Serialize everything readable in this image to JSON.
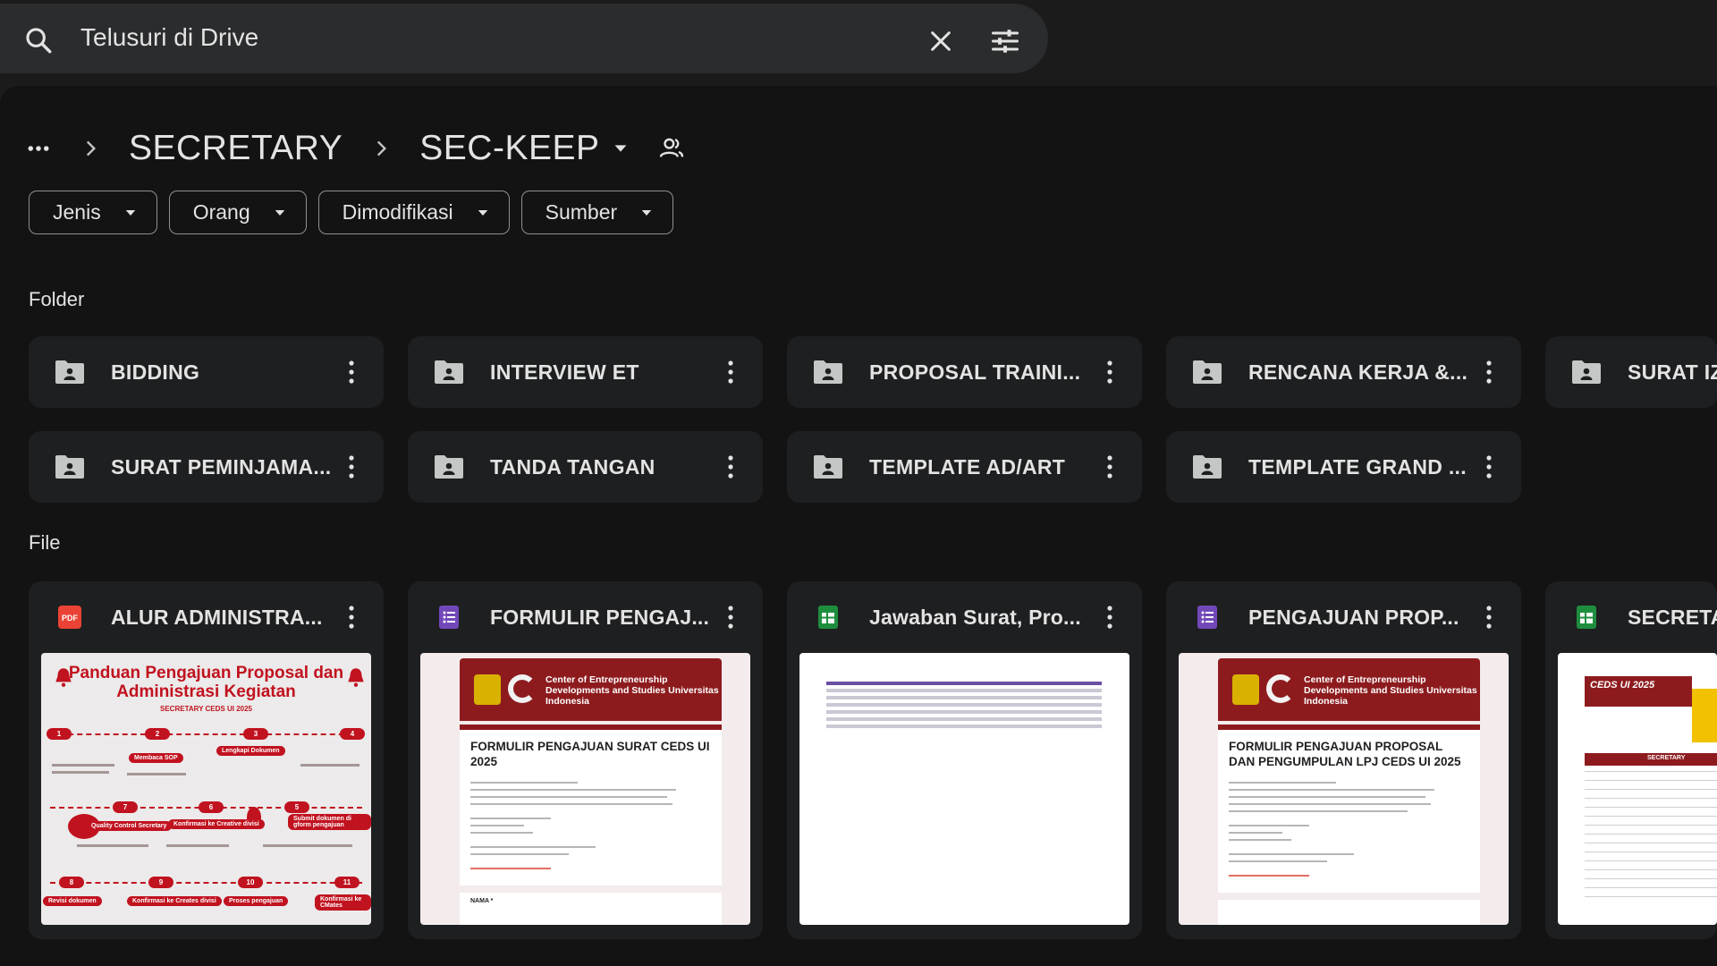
{
  "search": {
    "placeholder": "Telusuri di Drive"
  },
  "breadcrumb": {
    "parent": "SECRETARY",
    "current": "SEC-KEEP"
  },
  "filters": [
    "Jenis",
    "Orang",
    "Dimodifikasi",
    "Sumber"
  ],
  "sections": {
    "folders": "Folder",
    "files": "File"
  },
  "folders": [
    "BIDDING",
    "INTERVIEW ET",
    "PROPOSAL TRAINI...",
    "RENCANA KERJA &...",
    "SURAT IZI",
    "SURAT PEMINJAMA...",
    "TANDA TANGAN",
    "TEMPLATE AD/ART",
    "TEMPLATE GRAND ..."
  ],
  "files": [
    {
      "name": "ALUR ADMINISTRA...",
      "type": "pdf",
      "icon": "pdf-icon"
    },
    {
      "name": "FORMULIR PENGAJ...",
      "type": "form",
      "icon": "forms-icon"
    },
    {
      "name": "Jawaban Surat, Pro...",
      "type": "sheet",
      "icon": "sheets-icon"
    },
    {
      "name": "PENGAJUAN PROP...",
      "type": "form",
      "icon": "forms-icon"
    },
    {
      "name": "SECRETA",
      "type": "sheet",
      "icon": "sheets-icon"
    }
  ],
  "thumbs": {
    "info_title": "Panduan Pengajuan Proposal dan Administrasi Kegiatan",
    "info_sub": "SECRETARY CEDS UI 2025",
    "info_steps": [
      "1",
      "2",
      "3",
      "4",
      "7",
      "6",
      "5",
      "8",
      "9",
      "10",
      "11"
    ],
    "info_labels": [
      "Membaca SOP",
      "Lengkapi Dokumen",
      "Quality Control Secretary",
      "Konfirmasi ke Creative divisi",
      "Submit dokumen di gform pengajuan",
      "Revisi dokumen",
      "Konfirmasi ke Creates divisi",
      "Proses pengajuan",
      "Konfirmasi ke CMates"
    ],
    "org_name": "Center of Entrepreneurship Developments and Studies Universitas Indonesia",
    "form1_heading": "FORMULIR PENGAJUAN SURAT CEDS UI 2025",
    "form2_heading": "FORMULIR PENGAJUAN PROPOSAL DAN PENGUMPULAN LPJ CEDS UI 2025",
    "sheet5_head": "CEDS UI 2025",
    "sheet5_bar": "SECRETARY",
    "form_field": "NAMA *"
  },
  "colors": {
    "accent_red": "#8d1b1e",
    "folder_bg": "#1e1f20",
    "page_bg": "#131314",
    "pdf": "#ea4335",
    "forms": "#7248b9",
    "sheets": "#1e8e3e"
  }
}
